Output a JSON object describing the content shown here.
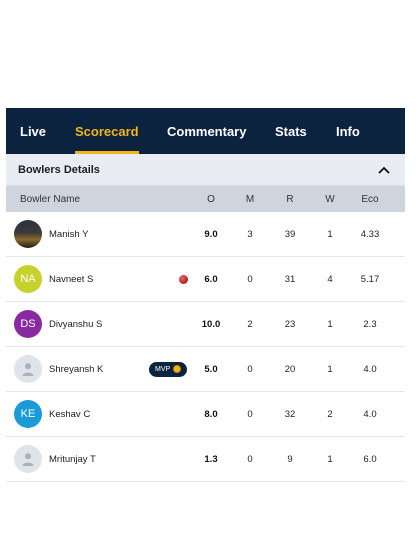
{
  "tabs": [
    {
      "label": "Live"
    },
    {
      "label": "Scorecard"
    },
    {
      "label": "Commentary"
    },
    {
      "label": "Stats"
    },
    {
      "label": "Info"
    }
  ],
  "active_tab": "Scorecard",
  "section": {
    "title": "Bowlers Details"
  },
  "columns": {
    "name": "Bowler Name",
    "o": "O",
    "m": "M",
    "r": "R",
    "w": "W",
    "eco": "Eco"
  },
  "bowlers": [
    {
      "name": "Manish Y",
      "avatar": "photo",
      "initials": "",
      "o": "9.0",
      "m": "3",
      "r": "39",
      "w": "1",
      "eco": "4.33"
    },
    {
      "name": "Navneet  S",
      "avatar": "initials",
      "initials": "NA",
      "avatar_color": "#c7d12b",
      "badge": "ball-icon",
      "o": "6.0",
      "m": "0",
      "r": "31",
      "w": "4",
      "eco": "5.17"
    },
    {
      "name": "Divyanshu S",
      "avatar": "initials",
      "initials": "DS",
      "avatar_color": "#8a2aa3",
      "o": "10.0",
      "m": "2",
      "r": "23",
      "w": "1",
      "eco": "2.3"
    },
    {
      "name": "Shreyansh K",
      "avatar": "placeholder",
      "initials": "",
      "badge": "mvp",
      "badge_label": "MVP",
      "o": "5.0",
      "m": "0",
      "r": "20",
      "w": "1",
      "eco": "4.0"
    },
    {
      "name": "Keshav C",
      "avatar": "initials",
      "initials": "KE",
      "avatar_color": "#1a9bd8",
      "o": "8.0",
      "m": "0",
      "r": "32",
      "w": "2",
      "eco": "4.0"
    },
    {
      "name": "Mritunjay T",
      "avatar": "placeholder",
      "initials": "",
      "o": "1.3",
      "m": "0",
      "r": "9",
      "w": "1",
      "eco": "6.0"
    }
  ],
  "colors": {
    "header_bg": "#0c2340",
    "accent": "#f5b415"
  }
}
